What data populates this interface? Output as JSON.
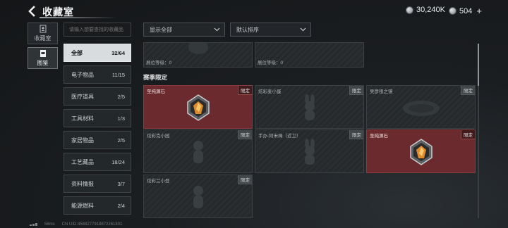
{
  "header": {
    "title": "收藏室",
    "currency": {
      "amount": "30,240K",
      "icon": "coin-icon"
    },
    "tokens": {
      "amount": "504",
      "icon": "token-icon",
      "plus": "+"
    }
  },
  "side_tabs": [
    {
      "label": "收藏室",
      "icon": "collection-room-icon",
      "active": false
    },
    {
      "label": "图鉴",
      "icon": "codex-icon",
      "active": true
    }
  ],
  "search": {
    "placeholder": "请输入想要查找的收藏品"
  },
  "categories": [
    {
      "label": "全部",
      "count": "32/64",
      "active": true
    },
    {
      "label": "电子物品",
      "count": "11/15"
    },
    {
      "label": "医疗道具",
      "count": "2/5"
    },
    {
      "label": "工具材料",
      "count": "1/3"
    },
    {
      "label": "家居物品",
      "count": "2/5"
    },
    {
      "label": "工艺藏品",
      "count": "18/24"
    },
    {
      "label": "资料情报",
      "count": "3/7"
    },
    {
      "label": "能源燃料",
      "count": "2/4"
    }
  ],
  "filters": {
    "display": {
      "value": "显示全部"
    },
    "sort": {
      "value": "默认排序"
    }
  },
  "top_cards": [
    {
      "level_label": "展位等级：0"
    },
    {
      "level_label": "展位等级：0"
    }
  ],
  "section": {
    "title": "赛季限定"
  },
  "cards": [
    {
      "name": "至纯源石",
      "badge": "限定",
      "found": true,
      "icon": "source-stone-icon"
    },
    {
      "name": "炫彩麦小蛋",
      "badge": "限定",
      "found": false,
      "icon": "rabbit-figure-icon"
    },
    {
      "name": "吴彦祖之镜",
      "badge": "限定",
      "found": false,
      "icon": "mirror-icon"
    },
    {
      "name": "炫彩克小园",
      "badge": "限定",
      "found": false,
      "icon": "figure-icon"
    },
    {
      "name": "手办-阿米姆（近卫）",
      "badge": "限定",
      "found": false,
      "icon": "rabbit-figure-icon"
    },
    {
      "name": "至纯源石",
      "badge": "限定",
      "found": true,
      "icon": "source-stone-icon"
    },
    {
      "name": "炫彩兰小登",
      "badge": "限定",
      "found": false,
      "icon": "figure-icon"
    }
  ],
  "status_bar": {
    "ping": "58ms",
    "uid": "CN UID:4588277918872261801"
  },
  "colors": {
    "accent_found": "#6b2b2e",
    "active_category": "#d9dcde"
  }
}
